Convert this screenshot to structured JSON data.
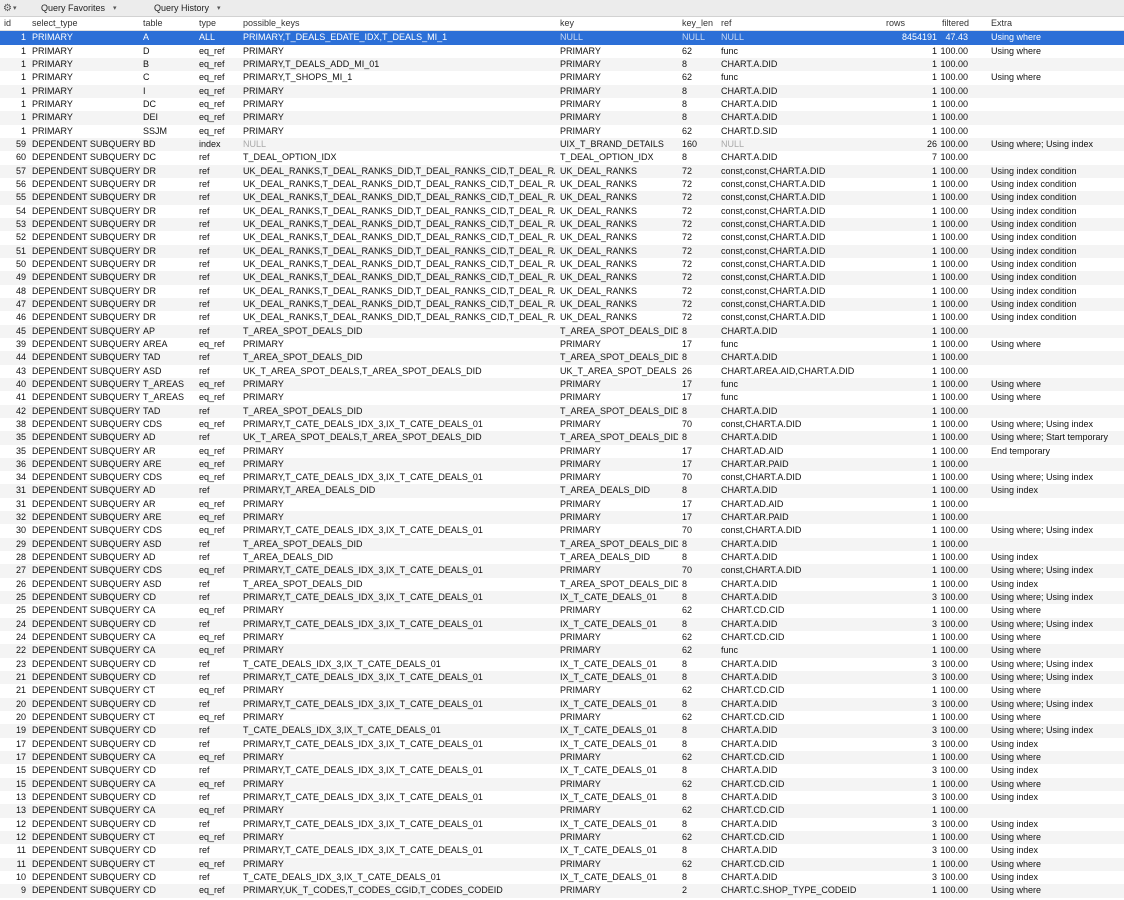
{
  "toolbar": {
    "gear_icon": "gear-icon",
    "favorites_label": "Query Favorites",
    "history_label": "Query History"
  },
  "colors": {
    "selection": "#2c6fd7",
    "stripe": "#f4f4f4",
    "null_text": "#a8a8a8"
  },
  "columns": [
    "id",
    "select_type",
    "table",
    "type",
    "possible_keys",
    "key",
    "key_len",
    "ref",
    "rows",
    "filtered",
    "Extra"
  ],
  "rows": [
    [
      "1",
      "PRIMARY",
      "A",
      "ALL",
      "PRIMARY,T_DEALS_EDATE_IDX,T_DEALS_MI_1",
      "NULL",
      "NULL",
      "NULL",
      "8454191",
      "47.43",
      "Using where"
    ],
    [
      "1",
      "PRIMARY",
      "D",
      "eq_ref",
      "PRIMARY",
      "PRIMARY",
      "62",
      "func",
      "1",
      "100.00",
      "Using where"
    ],
    [
      "1",
      "PRIMARY",
      "B",
      "eq_ref",
      "PRIMARY,T_DEALS_ADD_MI_01",
      "PRIMARY",
      "8",
      "CHART.A.DID",
      "1",
      "100.00",
      ""
    ],
    [
      "1",
      "PRIMARY",
      "C",
      "eq_ref",
      "PRIMARY,T_SHOPS_MI_1",
      "PRIMARY",
      "62",
      "func",
      "1",
      "100.00",
      "Using where"
    ],
    [
      "1",
      "PRIMARY",
      "I",
      "eq_ref",
      "PRIMARY",
      "PRIMARY",
      "8",
      "CHART.A.DID",
      "1",
      "100.00",
      ""
    ],
    [
      "1",
      "PRIMARY",
      "DC",
      "eq_ref",
      "PRIMARY",
      "PRIMARY",
      "8",
      "CHART.A.DID",
      "1",
      "100.00",
      ""
    ],
    [
      "1",
      "PRIMARY",
      "DEI",
      "eq_ref",
      "PRIMARY",
      "PRIMARY",
      "8",
      "CHART.A.DID",
      "1",
      "100.00",
      ""
    ],
    [
      "1",
      "PRIMARY",
      "SSJM",
      "eq_ref",
      "PRIMARY",
      "PRIMARY",
      "62",
      "CHART.D.SID",
      "1",
      "100.00",
      ""
    ],
    [
      "59",
      "DEPENDENT SUBQUERY",
      "BD",
      "index",
      "NULL",
      "UIX_T_BRAND_DETAILS",
      "160",
      "NULL",
      "26",
      "100.00",
      "Using where; Using index"
    ],
    [
      "60",
      "DEPENDENT SUBQUERY",
      "DC",
      "ref",
      "T_DEAL_OPTION_IDX",
      "T_DEAL_OPTION_IDX",
      "8",
      "CHART.A.DID",
      "7",
      "100.00",
      ""
    ],
    [
      "57",
      "DEPENDENT SUBQUERY",
      "DR",
      "ref",
      "UK_DEAL_RANKS,T_DEAL_RANKS_DID,T_DEAL_RANKS_CID,T_DEAL_RANKS_SITEID",
      "UK_DEAL_RANKS",
      "72",
      "const,const,CHART.A.DID",
      "1",
      "100.00",
      "Using index condition"
    ],
    [
      "56",
      "DEPENDENT SUBQUERY",
      "DR",
      "ref",
      "UK_DEAL_RANKS,T_DEAL_RANKS_DID,T_DEAL_RANKS_CID,T_DEAL_RANKS_SITEID",
      "UK_DEAL_RANKS",
      "72",
      "const,const,CHART.A.DID",
      "1",
      "100.00",
      "Using index condition"
    ],
    [
      "55",
      "DEPENDENT SUBQUERY",
      "DR",
      "ref",
      "UK_DEAL_RANKS,T_DEAL_RANKS_DID,T_DEAL_RANKS_CID,T_DEAL_RANKS_SITEID",
      "UK_DEAL_RANKS",
      "72",
      "const,const,CHART.A.DID",
      "1",
      "100.00",
      "Using index condition"
    ],
    [
      "54",
      "DEPENDENT SUBQUERY",
      "DR",
      "ref",
      "UK_DEAL_RANKS,T_DEAL_RANKS_DID,T_DEAL_RANKS_CID,T_DEAL_RANKS_SITEID",
      "UK_DEAL_RANKS",
      "72",
      "const,const,CHART.A.DID",
      "1",
      "100.00",
      "Using index condition"
    ],
    [
      "53",
      "DEPENDENT SUBQUERY",
      "DR",
      "ref",
      "UK_DEAL_RANKS,T_DEAL_RANKS_DID,T_DEAL_RANKS_CID,T_DEAL_RANKS_SITEID",
      "UK_DEAL_RANKS",
      "72",
      "const,const,CHART.A.DID",
      "1",
      "100.00",
      "Using index condition"
    ],
    [
      "52",
      "DEPENDENT SUBQUERY",
      "DR",
      "ref",
      "UK_DEAL_RANKS,T_DEAL_RANKS_DID,T_DEAL_RANKS_CID,T_DEAL_RANKS_SITEID",
      "UK_DEAL_RANKS",
      "72",
      "const,const,CHART.A.DID",
      "1",
      "100.00",
      "Using index condition"
    ],
    [
      "51",
      "DEPENDENT SUBQUERY",
      "DR",
      "ref",
      "UK_DEAL_RANKS,T_DEAL_RANKS_DID,T_DEAL_RANKS_CID,T_DEAL_RANKS_SITEID",
      "UK_DEAL_RANKS",
      "72",
      "const,const,CHART.A.DID",
      "1",
      "100.00",
      "Using index condition"
    ],
    [
      "50",
      "DEPENDENT SUBQUERY",
      "DR",
      "ref",
      "UK_DEAL_RANKS,T_DEAL_RANKS_DID,T_DEAL_RANKS_CID,T_DEAL_RANKS_SITEID",
      "UK_DEAL_RANKS",
      "72",
      "const,const,CHART.A.DID",
      "1",
      "100.00",
      "Using index condition"
    ],
    [
      "49",
      "DEPENDENT SUBQUERY",
      "DR",
      "ref",
      "UK_DEAL_RANKS,T_DEAL_RANKS_DID,T_DEAL_RANKS_CID,T_DEAL_RANKS_SITEID",
      "UK_DEAL_RANKS",
      "72",
      "const,const,CHART.A.DID",
      "1",
      "100.00",
      "Using index condition"
    ],
    [
      "48",
      "DEPENDENT SUBQUERY",
      "DR",
      "ref",
      "UK_DEAL_RANKS,T_DEAL_RANKS_DID,T_DEAL_RANKS_CID,T_DEAL_RANKS_SITEID",
      "UK_DEAL_RANKS",
      "72",
      "const,const,CHART.A.DID",
      "1",
      "100.00",
      "Using index condition"
    ],
    [
      "47",
      "DEPENDENT SUBQUERY",
      "DR",
      "ref",
      "UK_DEAL_RANKS,T_DEAL_RANKS_DID,T_DEAL_RANKS_CID,T_DEAL_RANKS_SITEID",
      "UK_DEAL_RANKS",
      "72",
      "const,const,CHART.A.DID",
      "1",
      "100.00",
      "Using index condition"
    ],
    [
      "46",
      "DEPENDENT SUBQUERY",
      "DR",
      "ref",
      "UK_DEAL_RANKS,T_DEAL_RANKS_DID,T_DEAL_RANKS_CID,T_DEAL_RANKS_SITEID",
      "UK_DEAL_RANKS",
      "72",
      "const,const,CHART.A.DID",
      "1",
      "100.00",
      "Using index condition"
    ],
    [
      "45",
      "DEPENDENT SUBQUERY",
      "AP",
      "ref",
      "T_AREA_SPOT_DEALS_DID",
      "T_AREA_SPOT_DEALS_DID",
      "8",
      "CHART.A.DID",
      "1",
      "100.00",
      ""
    ],
    [
      "39",
      "DEPENDENT SUBQUERY",
      "AREA",
      "eq_ref",
      "PRIMARY",
      "PRIMARY",
      "17",
      "func",
      "1",
      "100.00",
      "Using where"
    ],
    [
      "44",
      "DEPENDENT SUBQUERY",
      "TAD",
      "ref",
      "T_AREA_SPOT_DEALS_DID",
      "T_AREA_SPOT_DEALS_DID",
      "8",
      "CHART.A.DID",
      "1",
      "100.00",
      ""
    ],
    [
      "43",
      "DEPENDENT SUBQUERY",
      "ASD",
      "ref",
      "UK_T_AREA_SPOT_DEALS,T_AREA_SPOT_DEALS_DID",
      "UK_T_AREA_SPOT_DEALS",
      "26",
      "CHART.AREA.AID,CHART.A.DID",
      "1",
      "100.00",
      ""
    ],
    [
      "40",
      "DEPENDENT SUBQUERY",
      "T_AREAS",
      "eq_ref",
      "PRIMARY",
      "PRIMARY",
      "17",
      "func",
      "1",
      "100.00",
      "Using where"
    ],
    [
      "41",
      "DEPENDENT SUBQUERY",
      "T_AREAS",
      "eq_ref",
      "PRIMARY",
      "PRIMARY",
      "17",
      "func",
      "1",
      "100.00",
      "Using where"
    ],
    [
      "42",
      "DEPENDENT SUBQUERY",
      "TAD",
      "ref",
      "T_AREA_SPOT_DEALS_DID",
      "T_AREA_SPOT_DEALS_DID",
      "8",
      "CHART.A.DID",
      "1",
      "100.00",
      ""
    ],
    [
      "38",
      "DEPENDENT SUBQUERY",
      "CDS",
      "eq_ref",
      "PRIMARY,T_CATE_DEALS_IDX_3,IX_T_CATE_DEALS_01",
      "PRIMARY",
      "70",
      "const,CHART.A.DID",
      "1",
      "100.00",
      "Using where; Using index"
    ],
    [
      "35",
      "DEPENDENT SUBQUERY",
      "AD",
      "ref",
      "UK_T_AREA_SPOT_DEALS,T_AREA_SPOT_DEALS_DID",
      "T_AREA_SPOT_DEALS_DID",
      "8",
      "CHART.A.DID",
      "1",
      "100.00",
      "Using where; Start temporary"
    ],
    [
      "35",
      "DEPENDENT SUBQUERY",
      "AR",
      "eq_ref",
      "PRIMARY",
      "PRIMARY",
      "17",
      "CHART.AD.AID",
      "1",
      "100.00",
      "End temporary"
    ],
    [
      "36",
      "DEPENDENT SUBQUERY",
      "ARE",
      "eq_ref",
      "PRIMARY",
      "PRIMARY",
      "17",
      "CHART.AR.PAID",
      "1",
      "100.00",
      ""
    ],
    [
      "34",
      "DEPENDENT SUBQUERY",
      "CDS",
      "eq_ref",
      "PRIMARY,T_CATE_DEALS_IDX_3,IX_T_CATE_DEALS_01",
      "PRIMARY",
      "70",
      "const,CHART.A.DID",
      "1",
      "100.00",
      "Using where; Using index"
    ],
    [
      "31",
      "DEPENDENT SUBQUERY",
      "AD",
      "ref",
      "PRIMARY,T_AREA_DEALS_DID",
      "T_AREA_DEALS_DID",
      "8",
      "CHART.A.DID",
      "1",
      "100.00",
      "Using index"
    ],
    [
      "31",
      "DEPENDENT SUBQUERY",
      "AR",
      "eq_ref",
      "PRIMARY",
      "PRIMARY",
      "17",
      "CHART.AD.AID",
      "1",
      "100.00",
      ""
    ],
    [
      "32",
      "DEPENDENT SUBQUERY",
      "ARE",
      "eq_ref",
      "PRIMARY",
      "PRIMARY",
      "17",
      "CHART.AR.PAID",
      "1",
      "100.00",
      ""
    ],
    [
      "30",
      "DEPENDENT SUBQUERY",
      "CDS",
      "eq_ref",
      "PRIMARY,T_CATE_DEALS_IDX_3,IX_T_CATE_DEALS_01",
      "PRIMARY",
      "70",
      "const,CHART.A.DID",
      "1",
      "100.00",
      "Using where; Using index"
    ],
    [
      "29",
      "DEPENDENT SUBQUERY",
      "ASD",
      "ref",
      "T_AREA_SPOT_DEALS_DID",
      "T_AREA_SPOT_DEALS_DID",
      "8",
      "CHART.A.DID",
      "1",
      "100.00",
      ""
    ],
    [
      "28",
      "DEPENDENT SUBQUERY",
      "AD",
      "ref",
      "T_AREA_DEALS_DID",
      "T_AREA_DEALS_DID",
      "8",
      "CHART.A.DID",
      "1",
      "100.00",
      "Using index"
    ],
    [
      "27",
      "DEPENDENT SUBQUERY",
      "CDS",
      "eq_ref",
      "PRIMARY,T_CATE_DEALS_IDX_3,IX_T_CATE_DEALS_01",
      "PRIMARY",
      "70",
      "const,CHART.A.DID",
      "1",
      "100.00",
      "Using where; Using index"
    ],
    [
      "26",
      "DEPENDENT SUBQUERY",
      "ASD",
      "ref",
      "T_AREA_SPOT_DEALS_DID",
      "T_AREA_SPOT_DEALS_DID",
      "8",
      "CHART.A.DID",
      "1",
      "100.00",
      "Using index"
    ],
    [
      "25",
      "DEPENDENT SUBQUERY",
      "CD",
      "ref",
      "PRIMARY,T_CATE_DEALS_IDX_3,IX_T_CATE_DEALS_01",
      "IX_T_CATE_DEALS_01",
      "8",
      "CHART.A.DID",
      "3",
      "100.00",
      "Using where; Using index"
    ],
    [
      "25",
      "DEPENDENT SUBQUERY",
      "CA",
      "eq_ref",
      "PRIMARY",
      "PRIMARY",
      "62",
      "CHART.CD.CID",
      "1",
      "100.00",
      "Using where"
    ],
    [
      "24",
      "DEPENDENT SUBQUERY",
      "CD",
      "ref",
      "PRIMARY,T_CATE_DEALS_IDX_3,IX_T_CATE_DEALS_01",
      "IX_T_CATE_DEALS_01",
      "8",
      "CHART.A.DID",
      "3",
      "100.00",
      "Using where; Using index"
    ],
    [
      "24",
      "DEPENDENT SUBQUERY",
      "CA",
      "eq_ref",
      "PRIMARY",
      "PRIMARY",
      "62",
      "CHART.CD.CID",
      "1",
      "100.00",
      "Using where"
    ],
    [
      "22",
      "DEPENDENT SUBQUERY",
      "CA",
      "eq_ref",
      "PRIMARY",
      "PRIMARY",
      "62",
      "func",
      "1",
      "100.00",
      "Using where"
    ],
    [
      "23",
      "DEPENDENT SUBQUERY",
      "CD",
      "ref",
      "T_CATE_DEALS_IDX_3,IX_T_CATE_DEALS_01",
      "IX_T_CATE_DEALS_01",
      "8",
      "CHART.A.DID",
      "3",
      "100.00",
      "Using where; Using index"
    ],
    [
      "21",
      "DEPENDENT SUBQUERY",
      "CD",
      "ref",
      "PRIMARY,T_CATE_DEALS_IDX_3,IX_T_CATE_DEALS_01",
      "IX_T_CATE_DEALS_01",
      "8",
      "CHART.A.DID",
      "3",
      "100.00",
      "Using where; Using index"
    ],
    [
      "21",
      "DEPENDENT SUBQUERY",
      "CT",
      "eq_ref",
      "PRIMARY",
      "PRIMARY",
      "62",
      "CHART.CD.CID",
      "1",
      "100.00",
      "Using where"
    ],
    [
      "20",
      "DEPENDENT SUBQUERY",
      "CD",
      "ref",
      "PRIMARY,T_CATE_DEALS_IDX_3,IX_T_CATE_DEALS_01",
      "IX_T_CATE_DEALS_01",
      "8",
      "CHART.A.DID",
      "3",
      "100.00",
      "Using where; Using index"
    ],
    [
      "20",
      "DEPENDENT SUBQUERY",
      "CT",
      "eq_ref",
      "PRIMARY",
      "PRIMARY",
      "62",
      "CHART.CD.CID",
      "1",
      "100.00",
      "Using where"
    ],
    [
      "19",
      "DEPENDENT SUBQUERY",
      "CD",
      "ref",
      "T_CATE_DEALS_IDX_3,IX_T_CATE_DEALS_01",
      "IX_T_CATE_DEALS_01",
      "8",
      "CHART.A.DID",
      "3",
      "100.00",
      "Using where; Using index"
    ],
    [
      "17",
      "DEPENDENT SUBQUERY",
      "CD",
      "ref",
      "PRIMARY,T_CATE_DEALS_IDX_3,IX_T_CATE_DEALS_01",
      "IX_T_CATE_DEALS_01",
      "8",
      "CHART.A.DID",
      "3",
      "100.00",
      "Using index"
    ],
    [
      "17",
      "DEPENDENT SUBQUERY",
      "CA",
      "eq_ref",
      "PRIMARY",
      "PRIMARY",
      "62",
      "CHART.CD.CID",
      "1",
      "100.00",
      "Using where"
    ],
    [
      "15",
      "DEPENDENT SUBQUERY",
      "CD",
      "ref",
      "PRIMARY,T_CATE_DEALS_IDX_3,IX_T_CATE_DEALS_01",
      "IX_T_CATE_DEALS_01",
      "8",
      "CHART.A.DID",
      "3",
      "100.00",
      "Using index"
    ],
    [
      "15",
      "DEPENDENT SUBQUERY",
      "CA",
      "eq_ref",
      "PRIMARY",
      "PRIMARY",
      "62",
      "CHART.CD.CID",
      "1",
      "100.00",
      "Using where"
    ],
    [
      "13",
      "DEPENDENT SUBQUERY",
      "CD",
      "ref",
      "PRIMARY,T_CATE_DEALS_IDX_3,IX_T_CATE_DEALS_01",
      "IX_T_CATE_DEALS_01",
      "8",
      "CHART.A.DID",
      "3",
      "100.00",
      "Using index"
    ],
    [
      "13",
      "DEPENDENT SUBQUERY",
      "CA",
      "eq_ref",
      "PRIMARY",
      "PRIMARY",
      "62",
      "CHART.CD.CID",
      "1",
      "100.00",
      ""
    ],
    [
      "12",
      "DEPENDENT SUBQUERY",
      "CD",
      "ref",
      "PRIMARY,T_CATE_DEALS_IDX_3,IX_T_CATE_DEALS_01",
      "IX_T_CATE_DEALS_01",
      "8",
      "CHART.A.DID",
      "3",
      "100.00",
      "Using index"
    ],
    [
      "12",
      "DEPENDENT SUBQUERY",
      "CT",
      "eq_ref",
      "PRIMARY",
      "PRIMARY",
      "62",
      "CHART.CD.CID",
      "1",
      "100.00",
      "Using where"
    ],
    [
      "11",
      "DEPENDENT SUBQUERY",
      "CD",
      "ref",
      "PRIMARY,T_CATE_DEALS_IDX_3,IX_T_CATE_DEALS_01",
      "IX_T_CATE_DEALS_01",
      "8",
      "CHART.A.DID",
      "3",
      "100.00",
      "Using index"
    ],
    [
      "11",
      "DEPENDENT SUBQUERY",
      "CT",
      "eq_ref",
      "PRIMARY",
      "PRIMARY",
      "62",
      "CHART.CD.CID",
      "1",
      "100.00",
      "Using where"
    ],
    [
      "10",
      "DEPENDENT SUBQUERY",
      "CD",
      "ref",
      "T_CATE_DEALS_IDX_3,IX_T_CATE_DEALS_01",
      "IX_T_CATE_DEALS_01",
      "8",
      "CHART.A.DID",
      "3",
      "100.00",
      "Using index"
    ],
    [
      "9",
      "DEPENDENT SUBQUERY",
      "CD",
      "eq_ref",
      "PRIMARY,UK_T_CODES,T_CODES_CGID,T_CODES_CODEID",
      "PRIMARY",
      "2",
      "CHART.C.SHOP_TYPE_CODEID",
      "1",
      "100.00",
      "Using where"
    ]
  ]
}
